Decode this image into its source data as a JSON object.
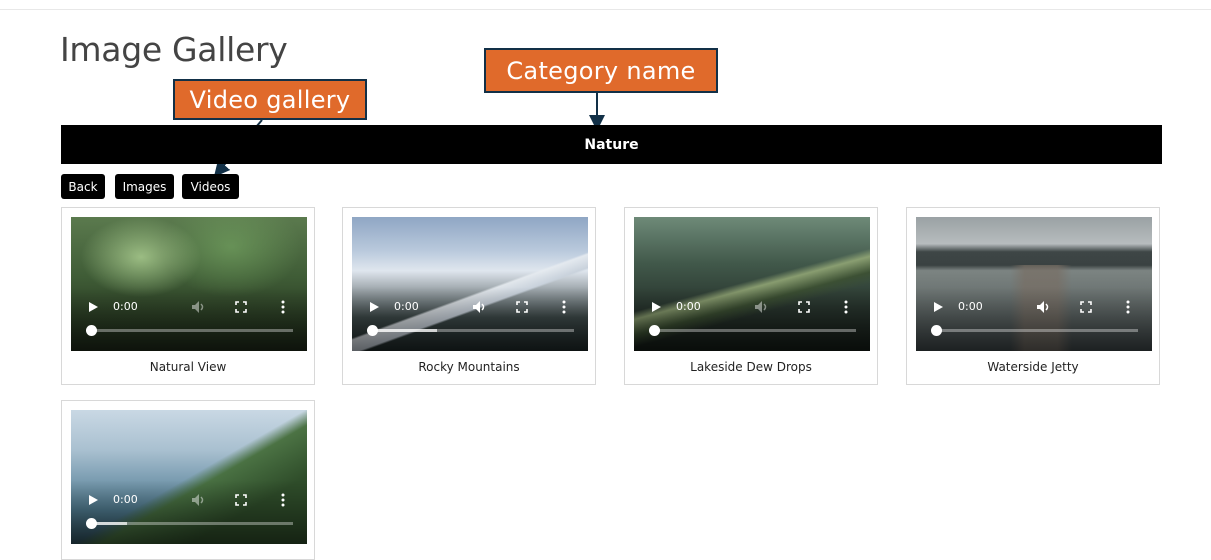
{
  "page": {
    "title": "Image Gallery"
  },
  "annotations": {
    "video_gallery": "Video gallery",
    "category_name": "Category name"
  },
  "category": {
    "name": "Nature"
  },
  "nav": {
    "back": "Back",
    "images": "Images",
    "videos": "Videos"
  },
  "videos": [
    {
      "title": "Natural View",
      "time": "0:00",
      "muted": true,
      "buffered": 0.0
    },
    {
      "title": "Rocky Mountains",
      "time": "0:00",
      "muted": false,
      "buffered": 0.32
    },
    {
      "title": "Lakeside Dew Drops",
      "time": "0:00",
      "muted": true,
      "buffered": 0.0
    },
    {
      "title": "Waterside Jetty",
      "time": "0:00",
      "muted": false,
      "buffered": 0.0
    },
    {
      "title": "",
      "time": "0:00",
      "muted": true,
      "buffered": 0.18
    }
  ],
  "colors": {
    "callout_fill": "#e06a2b",
    "callout_border": "#123047",
    "bar": "#000000"
  },
  "icons": [
    "play-icon",
    "volume-icon",
    "fullscreen-icon",
    "more-options-icon"
  ]
}
